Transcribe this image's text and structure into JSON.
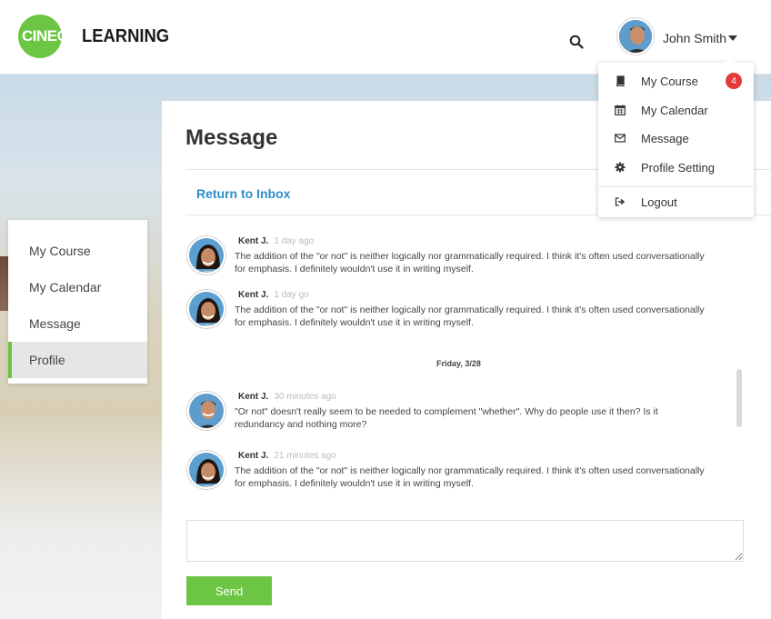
{
  "header": {
    "logo_badge": "CINEC",
    "logo_word": "LEARNING",
    "user_name": "John Smith"
  },
  "dropdown": {
    "items": [
      {
        "label": "My Course",
        "icon": "book-icon",
        "badge": "4"
      },
      {
        "label": "My Calendar",
        "icon": "calendar-icon"
      },
      {
        "label": "Message",
        "icon": "envelope-icon"
      },
      {
        "label": "Profile Setting",
        "icon": "gear-icon"
      },
      {
        "label": "Logout",
        "icon": "sign-out-icon"
      }
    ]
  },
  "sidebar": {
    "items": [
      {
        "label": "My Course"
      },
      {
        "label": "My Calendar"
      },
      {
        "label": "Message"
      },
      {
        "label": "Profile",
        "active": true
      }
    ]
  },
  "main": {
    "title": "Message",
    "return_link": "Return to Inbox",
    "date_separator": "Friday, 3/28",
    "messages": [
      {
        "author": "Kent J.",
        "time": "1 day ago",
        "text": "The addition of the \"or not\" is neither logically nor grammatically required. I think it's often used conversationally for emphasis. I definitely wouldn't use it in writing myself."
      },
      {
        "author": "Kent J.",
        "time": "1 day go",
        "text": "The addition of the \"or not\" is neither logically nor grammatically required. I think it's often used conversationally for emphasis. I definitely wouldn't use it in writing myself."
      },
      {
        "author": "Kent J.",
        "time": "30 minutes ago",
        "text": "\"Or not\" doesn't really seem to be needed to complement \"whether\". Why do people use it then? Is it redundancy and nothing more?"
      },
      {
        "author": "Kent J.",
        "time": "21 minutes ago",
        "text": "The addition of the \"or not\" is neither logically nor grammatically required. I think it's often used conversationally for emphasis. I definitely wouldn't use it in writing myself."
      }
    ],
    "reply_value": "",
    "send_label": "Send"
  },
  "colors": {
    "brand_green": "#6cc644",
    "link_blue": "#2d8dc9",
    "badge_red": "#e53a3a"
  }
}
